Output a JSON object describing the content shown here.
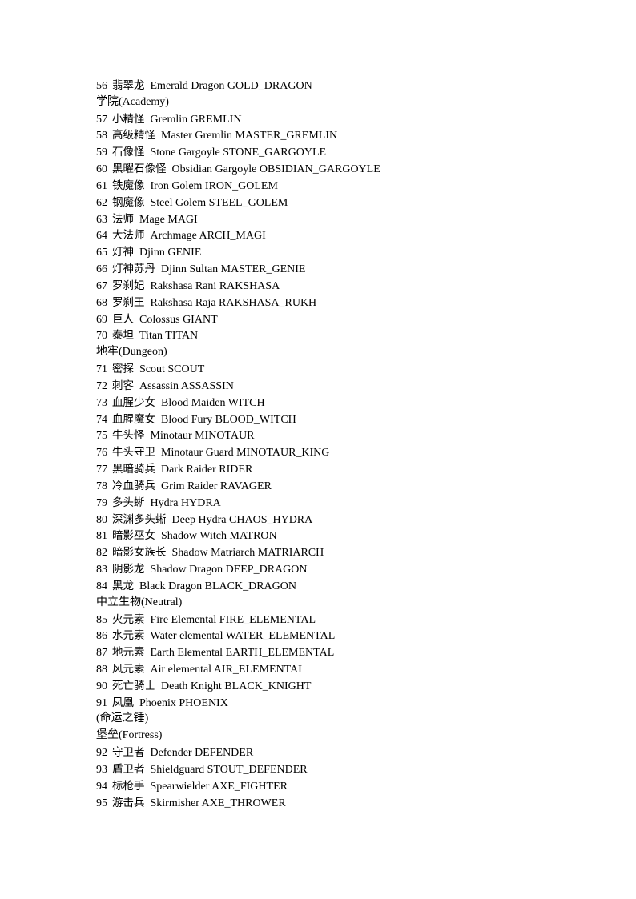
{
  "document": {
    "lines": [
      {
        "type": "entry",
        "num": "56",
        "cn": "翡翠龙",
        "en": "Emerald Dragon GOLD_DRAGON"
      },
      {
        "type": "heading",
        "text": "学院(Academy)"
      },
      {
        "type": "entry",
        "num": "57",
        "cn": "小精怪",
        "en": "Gremlin GREMLIN"
      },
      {
        "type": "entry",
        "num": "58",
        "cn": "高级精怪",
        "en": "Master Gremlin MASTER_GREMLIN"
      },
      {
        "type": "entry",
        "num": "59",
        "cn": "石像怪",
        "en": "Stone Gargoyle STONE_GARGOYLE"
      },
      {
        "type": "entry",
        "num": "60",
        "cn": "黑曜石像怪",
        "en": "Obsidian Gargoyle OBSIDIAN_GARGOYLE"
      },
      {
        "type": "entry",
        "num": "61",
        "cn": "铁魔像",
        "en": "Iron Golem IRON_GOLEM"
      },
      {
        "type": "entry",
        "num": "62",
        "cn": "钢魔像",
        "en": "Steel Golem STEEL_GOLEM"
      },
      {
        "type": "entry",
        "num": "63",
        "cn": "法师",
        "en": "Mage MAGI"
      },
      {
        "type": "entry",
        "num": "64",
        "cn": "大法师",
        "en": "Archmage ARCH_MAGI"
      },
      {
        "type": "entry",
        "num": "65",
        "cn": "灯神",
        "en": "Djinn GENIE"
      },
      {
        "type": "entry",
        "num": "66",
        "cn": "灯神苏丹",
        "en": "Djinn Sultan MASTER_GENIE"
      },
      {
        "type": "entry",
        "num": "67",
        "cn": "罗刹妃",
        "en": "Rakshasa Rani RAKSHASA"
      },
      {
        "type": "entry",
        "num": "68",
        "cn": "罗刹王",
        "en": "Rakshasa Raja RAKSHASA_RUKH"
      },
      {
        "type": "entry",
        "num": "69",
        "cn": "巨人",
        "en": "Colossus GIANT"
      },
      {
        "type": "entry",
        "num": "70",
        "cn": "泰坦",
        "en": "Titan TITAN"
      },
      {
        "type": "heading",
        "text": "地牢(Dungeon)"
      },
      {
        "type": "entry",
        "num": "71",
        "cn": "密探",
        "en": "Scout SCOUT"
      },
      {
        "type": "entry",
        "num": "72",
        "cn": "刺客",
        "en": "Assassin ASSASSIN"
      },
      {
        "type": "entry",
        "num": "73",
        "cn": "血腥少女",
        "en": "Blood Maiden WITCH"
      },
      {
        "type": "entry",
        "num": "74",
        "cn": "血腥魔女",
        "en": "Blood Fury BLOOD_WITCH"
      },
      {
        "type": "entry",
        "num": "75",
        "cn": "牛头怪",
        "en": "Minotaur MINOTAUR"
      },
      {
        "type": "entry",
        "num": "76",
        "cn": "牛头守卫",
        "en": "Minotaur Guard MINOTAUR_KING"
      },
      {
        "type": "entry",
        "num": "77",
        "cn": "黑暗骑兵",
        "en": "Dark Raider RIDER"
      },
      {
        "type": "entry",
        "num": "78",
        "cn": "冷血骑兵",
        "en": "Grim Raider RAVAGER"
      },
      {
        "type": "entry",
        "num": "79",
        "cn": "多头蜥",
        "en": "Hydra HYDRA"
      },
      {
        "type": "entry",
        "num": "80",
        "cn": "深渊多头蜥",
        "en": "Deep Hydra CHAOS_HYDRA"
      },
      {
        "type": "entry",
        "num": "81",
        "cn": "暗影巫女",
        "en": "Shadow Witch MATRON"
      },
      {
        "type": "entry",
        "num": "82",
        "cn": "暗影女族长",
        "en": "Shadow Matriarch MATRIARCH"
      },
      {
        "type": "entry",
        "num": "83",
        "cn": "阴影龙",
        "en": "Shadow Dragon DEEP_DRAGON"
      },
      {
        "type": "entry",
        "num": "84",
        "cn": "黑龙",
        "en": "Black Dragon BLACK_DRAGON"
      },
      {
        "type": "heading",
        "text": "中立生物(Neutral)"
      },
      {
        "type": "entry",
        "num": "85",
        "cn": "火元素",
        "en": "Fire Elemental FIRE_ELEMENTAL"
      },
      {
        "type": "entry",
        "num": "86",
        "cn": "水元素",
        "en": "Water elemental WATER_ELEMENTAL"
      },
      {
        "type": "entry",
        "num": "87",
        "cn": "地元素",
        "en": "Earth Elemental EARTH_ELEMENTAL"
      },
      {
        "type": "entry",
        "num": "88",
        "cn": "风元素",
        "en": "Air elemental AIR_ELEMENTAL"
      },
      {
        "type": "entry",
        "num": "90",
        "cn": "死亡骑士",
        "en": "Death Knight BLACK_KNIGHT"
      },
      {
        "type": "entry",
        "num": "91",
        "cn": "凤凰",
        "en": "Phoenix PHOENIX"
      },
      {
        "type": "heading",
        "text": "(命运之锤)"
      },
      {
        "type": "heading",
        "text": "堡垒(Fortress)"
      },
      {
        "type": "entry",
        "num": "92",
        "cn": "守卫者",
        "en": "Defender DEFENDER"
      },
      {
        "type": "entry",
        "num": "93",
        "cn": "盾卫者",
        "en": "Shieldguard STOUT_DEFENDER"
      },
      {
        "type": "entry",
        "num": "94",
        "cn": "标枪手",
        "en": "Spearwielder AXE_FIGHTER"
      },
      {
        "type": "entry",
        "num": "95",
        "cn": "游击兵",
        "en": "Skirmisher AXE_THROWER"
      }
    ]
  }
}
